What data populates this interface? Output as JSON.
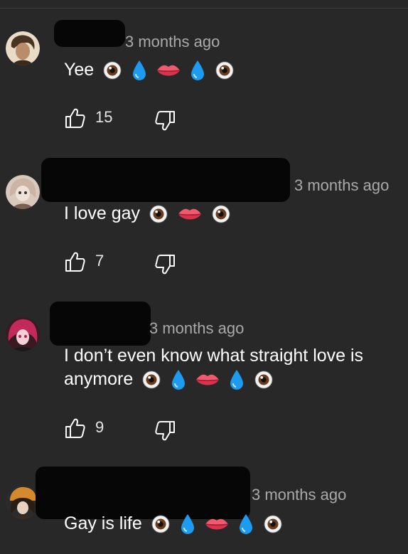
{
  "comments": [
    {
      "time": "3 months ago",
      "text": "Yee",
      "emojis": [
        "eye-emoji",
        "droplet-emoji",
        "lips-emoji",
        "droplet-emoji",
        "eye-emoji"
      ],
      "likes": "15"
    },
    {
      "time": "3 months ago",
      "text": "I love gay",
      "emojis": [
        "eye-emoji",
        "lips-emoji",
        "eye-emoji"
      ],
      "likes": "7"
    },
    {
      "time": "3 months ago",
      "text_line1": "I don’t even know what straight love is",
      "text_line2": "anymore",
      "emojis": [
        "eye-emoji",
        "droplet-emoji",
        "lips-emoji",
        "droplet-emoji",
        "eye-emoji"
      ],
      "likes": "9"
    },
    {
      "time": "3 months ago",
      "text": "Gay is life",
      "emojis": [
        "eye-emoji",
        "droplet-emoji",
        "lips-emoji",
        "droplet-emoji",
        "eye-emoji"
      ]
    }
  ],
  "colors": {
    "background": "#282828",
    "meta_text": "#a9a9a9",
    "redaction": "#060606",
    "droplet": "#1da1f2",
    "lips": "#e83a5a"
  }
}
